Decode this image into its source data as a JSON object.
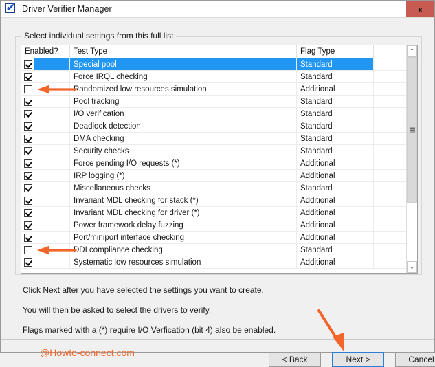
{
  "window": {
    "title": "Driver Verifier Manager",
    "icon": "verifier-checkmark-icon",
    "close_label": "x",
    "close_color": "#c75b51"
  },
  "groupbox": {
    "label": "Select individual settings from this full list"
  },
  "listview": {
    "columns": [
      "Enabled?",
      "Test Type",
      "Flag Type",
      ""
    ],
    "rows": [
      {
        "enabled": true,
        "test": "Special pool",
        "flag": "Standard",
        "selected": true
      },
      {
        "enabled": true,
        "test": "Force IRQL checking",
        "flag": "Standard",
        "selected": false
      },
      {
        "enabled": false,
        "test": "Randomized low resources simulation",
        "flag": "Additional",
        "selected": false
      },
      {
        "enabled": true,
        "test": "Pool tracking",
        "flag": "Standard",
        "selected": false
      },
      {
        "enabled": true,
        "test": "I/O verification",
        "flag": "Standard",
        "selected": false
      },
      {
        "enabled": true,
        "test": "Deadlock detection",
        "flag": "Standard",
        "selected": false
      },
      {
        "enabled": true,
        "test": "DMA checking",
        "flag": "Standard",
        "selected": false
      },
      {
        "enabled": true,
        "test": "Security checks",
        "flag": "Standard",
        "selected": false
      },
      {
        "enabled": true,
        "test": "Force pending I/O requests (*)",
        "flag": "Additional",
        "selected": false
      },
      {
        "enabled": true,
        "test": "IRP logging (*)",
        "flag": "Additional",
        "selected": false
      },
      {
        "enabled": true,
        "test": "Miscellaneous checks",
        "flag": "Standard",
        "selected": false
      },
      {
        "enabled": true,
        "test": "Invariant MDL checking for stack (*)",
        "flag": "Additional",
        "selected": false
      },
      {
        "enabled": true,
        "test": "Invariant MDL checking for driver (*)",
        "flag": "Additional",
        "selected": false
      },
      {
        "enabled": true,
        "test": "Power framework delay fuzzing",
        "flag": "Additional",
        "selected": false
      },
      {
        "enabled": true,
        "test": "Port/miniport interface checking",
        "flag": "Additional",
        "selected": false
      },
      {
        "enabled": false,
        "test": "DDI compliance checking",
        "flag": "Standard",
        "selected": false
      },
      {
        "enabled": true,
        "test": "Systematic low resources simulation",
        "flag": "Additional",
        "selected": false
      }
    ],
    "scrollbar": {
      "up_glyph": "⌃",
      "down_glyph": "⌄"
    }
  },
  "instructions": [
    "Click Next after you have selected the settings you want to create.",
    "You will then be asked to select the drivers to verify.",
    "Flags marked with a (*) require I/O Verfication (bit 4) also be enabled."
  ],
  "watermark": {
    "text": "@Howto-connect.com",
    "color": "#f2662a"
  },
  "buttons": {
    "back": "< Back",
    "next": "Next >",
    "cancel": "Cancel"
  },
  "annotations": {
    "color": "#f2662a",
    "arrow_rows": [
      2,
      15
    ],
    "arrow_next_button": true
  }
}
